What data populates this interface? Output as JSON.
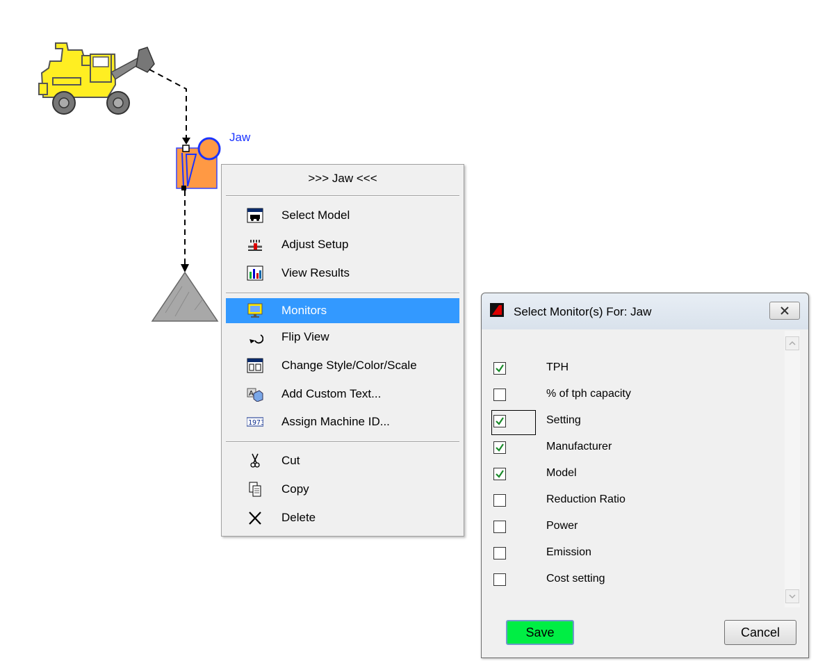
{
  "flowsheet": {
    "node_label": "Jaw",
    "loader_icon": "wheel-loader-icon",
    "crusher_icon": "jaw-crusher-icon",
    "pile_icon": "stockpile-icon"
  },
  "context_menu": {
    "title": ">>> Jaw  <<<",
    "items": [
      {
        "label": "Select Model",
        "icon": "select-model-icon"
      },
      {
        "label": "Adjust Setup",
        "icon": "adjust-setup-icon"
      },
      {
        "label": "View Results",
        "icon": "bar-chart-icon"
      },
      {
        "label": "Monitors",
        "icon": "monitor-icon",
        "highlighted": true
      },
      {
        "label": "Flip View",
        "icon": "flip-arrow-icon"
      },
      {
        "label": "Change Style/Color/Scale",
        "icon": "style-icon"
      },
      {
        "label": "Add Custom Text...",
        "icon": "custom-text-icon"
      },
      {
        "label": "Assign Machine ID...",
        "icon": "machine-id-icon"
      },
      {
        "label": "Cut",
        "icon": "scissors-icon"
      },
      {
        "label": "Copy",
        "icon": "copy-icon"
      },
      {
        "label": "Delete",
        "icon": "delete-x-icon"
      }
    ],
    "highlight_color": "#3399ff"
  },
  "dialog": {
    "title": "Select Monitor(s) For: Jaw",
    "items": [
      {
        "label": "TPH",
        "checked": true
      },
      {
        "label": "% of tph capacity",
        "checked": false
      },
      {
        "label": "Setting",
        "checked": true,
        "focused": true
      },
      {
        "label": "Manufacturer",
        "checked": true
      },
      {
        "label": "Model",
        "checked": true
      },
      {
        "label": "Reduction Ratio",
        "checked": false
      },
      {
        "label": "Power",
        "checked": false
      },
      {
        "label": "Emission",
        "checked": false
      },
      {
        "label": "Cost setting",
        "checked": false
      }
    ],
    "save_label": "Save",
    "cancel_label": "Cancel",
    "save_color": "#00ee44"
  }
}
